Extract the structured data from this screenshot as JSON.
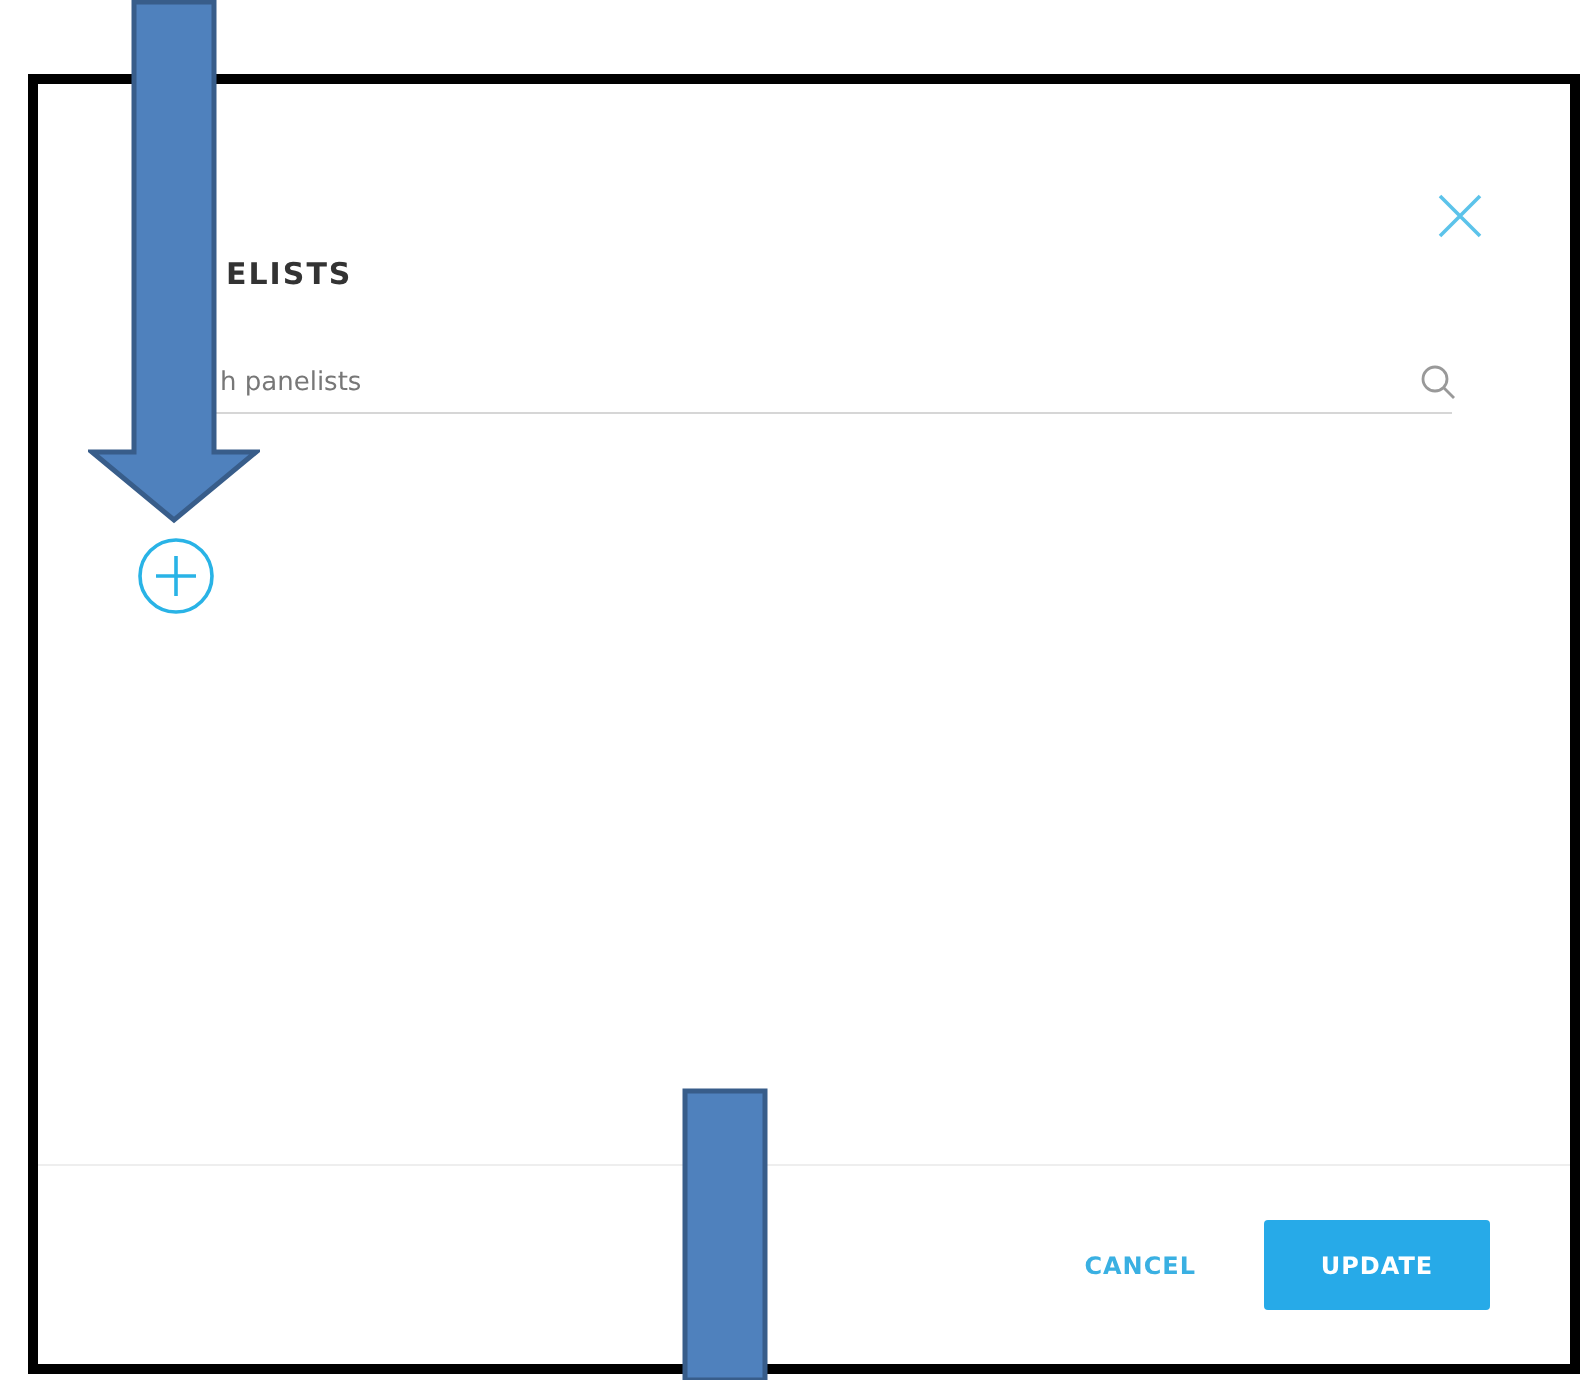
{
  "dialog": {
    "title": "ELISTS",
    "search": {
      "placeholder": "h panelists"
    },
    "buttons": [
      {
        "label": "CANCEL",
        "kind": "text"
      },
      {
        "label": "UPDATE",
        "kind": "primary"
      }
    ]
  }
}
